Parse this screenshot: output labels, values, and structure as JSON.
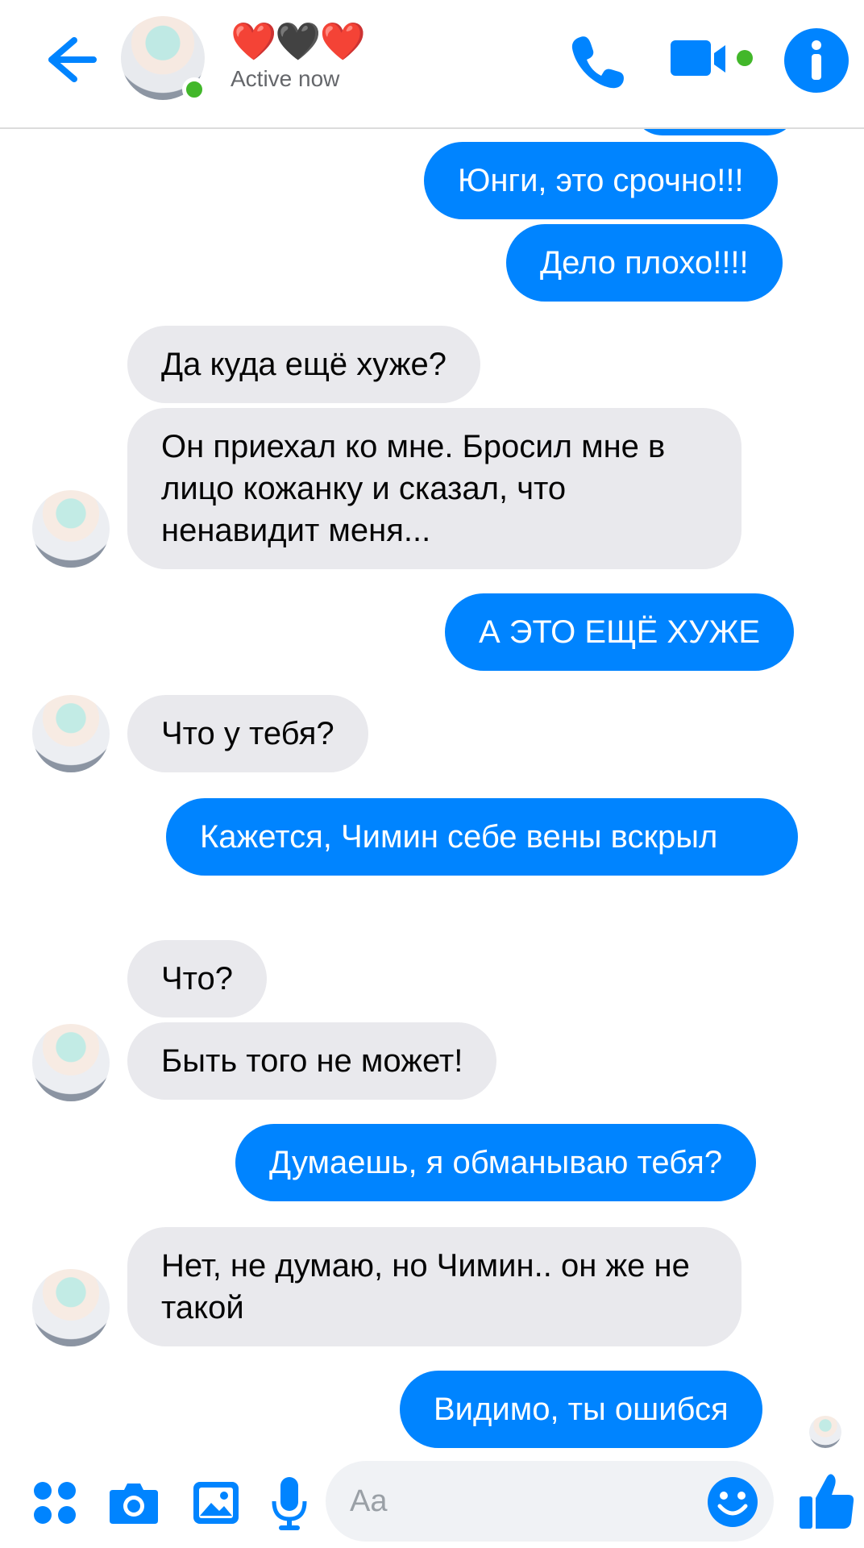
{
  "header": {
    "contact_name": "❤️🖤❤️",
    "status": "Active now"
  },
  "messages": [
    {
      "id": "m1",
      "side": "out",
      "text": "Юнги, это срочно!!!"
    },
    {
      "id": "m2",
      "side": "out",
      "text": "Дело плохо!!!!"
    },
    {
      "id": "m3",
      "side": "in",
      "text": "Да куда ещё хуже?"
    },
    {
      "id": "m4",
      "side": "in",
      "text": "Он приехал ко мне. Бросил мне в лицо кожанку и сказал, что ненавидит меня..."
    },
    {
      "id": "m5",
      "side": "out",
      "text": "А ЭТО ЕЩЁ ХУЖЕ"
    },
    {
      "id": "m6",
      "side": "in",
      "text": "Что у тебя?"
    },
    {
      "id": "m7",
      "side": "out",
      "text": "Кажется, Чимин себе вены вскрыл"
    },
    {
      "id": "m8",
      "side": "in",
      "text": "Что?"
    },
    {
      "id": "m9",
      "side": "in",
      "text": "Быть того не может!"
    },
    {
      "id": "m10",
      "side": "out",
      "text": "Думаешь, я обманываю тебя?"
    },
    {
      "id": "m11",
      "side": "in",
      "text": "Нет, не думаю, но Чимин.. он же не такой"
    },
    {
      "id": "m12",
      "side": "out",
      "text": "Видимо, ты ошибся"
    }
  ],
  "composer": {
    "placeholder": "Aa",
    "value": ""
  },
  "colors": {
    "accent": "#0084ff",
    "incoming_bubble": "#e9e9ed",
    "online": "#42b72a"
  },
  "icons": {
    "back": "arrow-left-icon",
    "call": "phone-icon",
    "video": "video-camera-icon",
    "info": "info-icon",
    "apps": "apps-grid-icon",
    "camera": "camera-icon",
    "gallery": "image-icon",
    "mic": "microphone-icon",
    "emoji": "smiley-icon",
    "like": "thumbs-up-icon"
  }
}
